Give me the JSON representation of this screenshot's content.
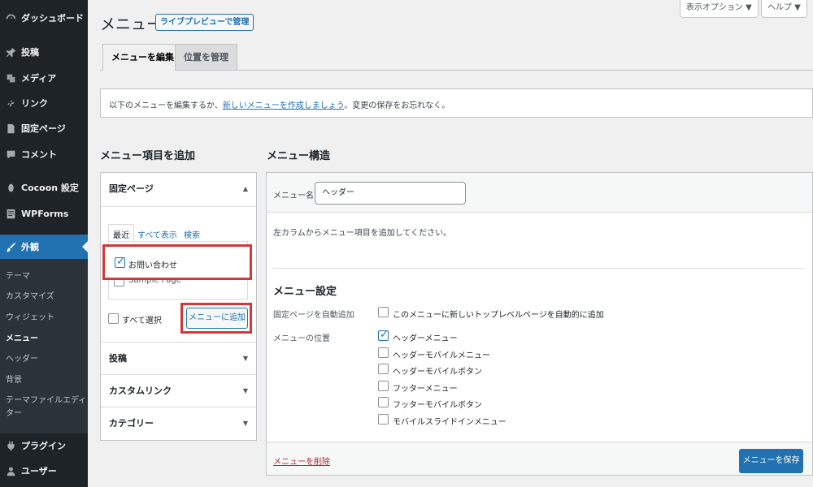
{
  "sidebar": {
    "items": [
      {
        "label": "ダッシュボード",
        "icon": "dashboard-icon"
      },
      {
        "label": "投稿",
        "icon": "pin-icon"
      },
      {
        "label": "メディア",
        "icon": "media-icon"
      },
      {
        "label": "リンク",
        "icon": "link-icon"
      },
      {
        "label": "固定ページ",
        "icon": "page-icon"
      },
      {
        "label": "コメント",
        "icon": "comment-icon"
      },
      {
        "label": "Cocoon 設定",
        "icon": "cocoon-icon"
      },
      {
        "label": "WPForms",
        "icon": "forms-icon"
      },
      {
        "label": "外観",
        "icon": "brush-icon"
      },
      {
        "label": "プラグイン",
        "icon": "plugin-icon"
      },
      {
        "label": "ユーザー",
        "icon": "user-icon"
      }
    ],
    "submenu": [
      "テーマ",
      "カスタマイズ",
      "ウィジェット",
      "メニュー",
      "ヘッダー",
      "背景",
      "テーマファイルエディ",
      "ター"
    ]
  },
  "header": {
    "title": "メニュー",
    "live_preview": "ライブプレビューで管理",
    "screen_options": "表示オプション ▼",
    "help": "ヘルプ ▼"
  },
  "tabs": {
    "edit": "メニューを編集",
    "locations": "位置を管理"
  },
  "notice": {
    "before": "以下のメニューを編集するか、",
    "link": "新しいメニューを作成しましょう",
    "after": "。変更の保存をお忘れなく。"
  },
  "left": {
    "heading": "メニュー項目を追加",
    "pages_title": "固定ページ",
    "mini_tabs": {
      "recent": "最近",
      "all": "すべて表示",
      "search": "検索"
    },
    "pages": [
      {
        "label": "お問い合わせ",
        "checked": true
      },
      {
        "label": "Sample Page",
        "checked": false
      }
    ],
    "select_all": "すべて選択",
    "add_button": "メニューに追加",
    "posts_title": "投稿",
    "custom_links_title": "カスタムリンク",
    "categories_title": "カテゴリー",
    "arrow_up": "▲",
    "arrow_down": "▼"
  },
  "right": {
    "heading": "メニュー構造",
    "menu_name_label": "メニュー名",
    "menu_name_value": "ヘッダー",
    "instruction": "左カラムからメニュー項目を追加してください。",
    "settings_heading": "メニュー設定",
    "auto_add_label": "固定ページを自動追加",
    "auto_add_option": "このメニューに新しいトップレベルページを自動的に追加",
    "location_label": "メニューの位置",
    "locations": [
      {
        "label": "ヘッダーメニュー",
        "checked": true
      },
      {
        "label": "ヘッダーモバイルメニュー",
        "checked": false
      },
      {
        "label": "ヘッダーモバイルボタン",
        "checked": false
      },
      {
        "label": "フッターメニュー",
        "checked": false
      },
      {
        "label": "フッターモバイルボタン",
        "checked": false
      },
      {
        "label": "モバイルスライドインメニュー",
        "checked": false
      }
    ],
    "delete_link": "メニューを削除",
    "save_button": "メニューを保存"
  },
  "colors": {
    "accent": "#2271b1",
    "sidebar": "#1d2327",
    "highlight": "#d63638"
  }
}
